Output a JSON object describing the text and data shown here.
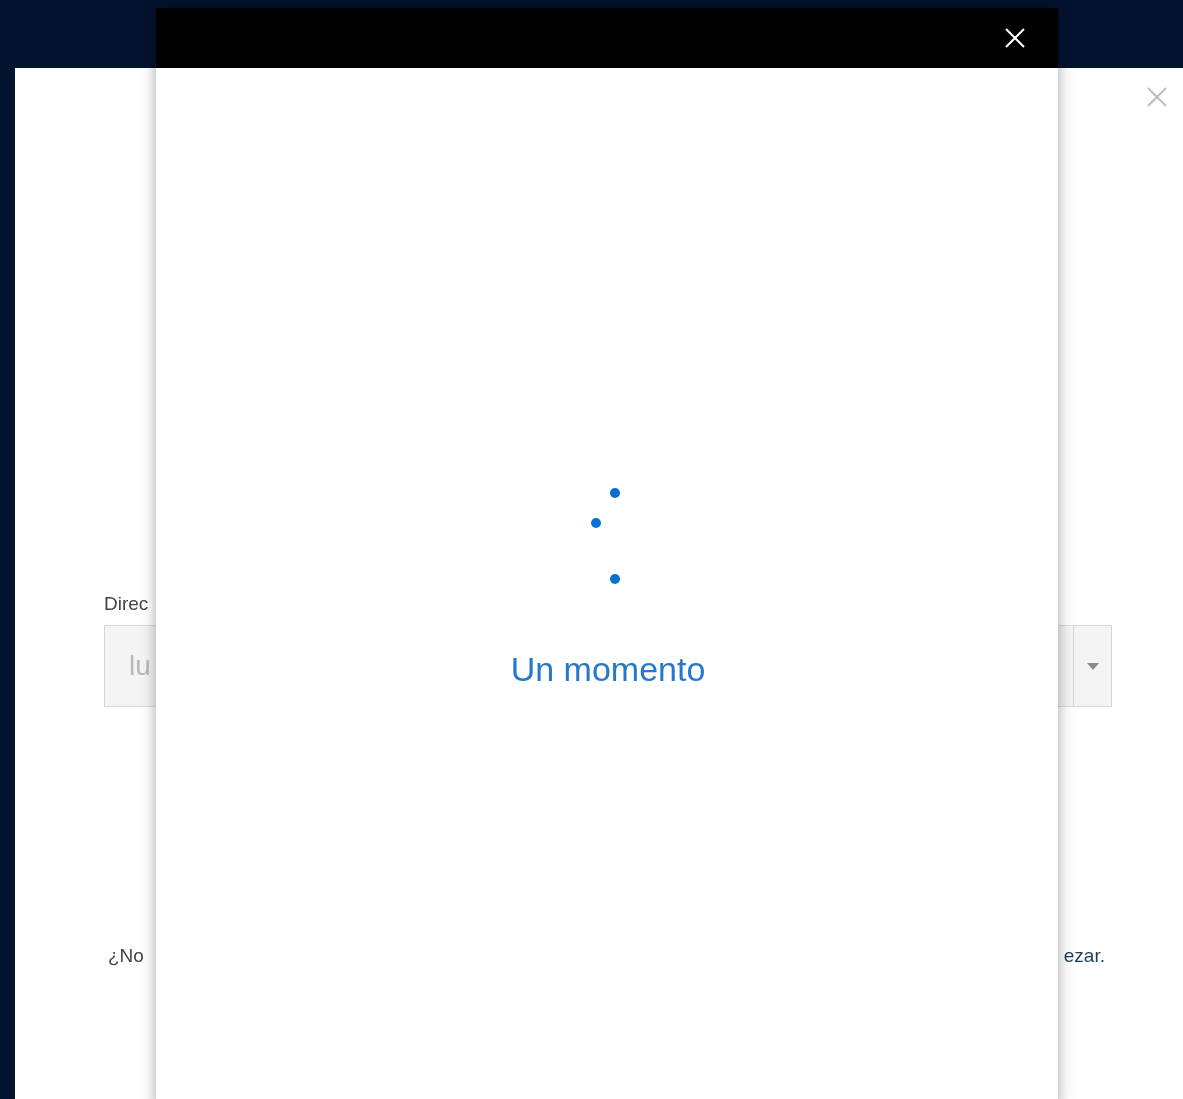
{
  "background_dialog": {
    "field_label": "Direc",
    "field": {
      "placeholder": "lu"
    },
    "footer_left": "¿No",
    "footer_right": "ezar."
  },
  "overlay_dialog": {
    "status": "Un momento"
  }
}
